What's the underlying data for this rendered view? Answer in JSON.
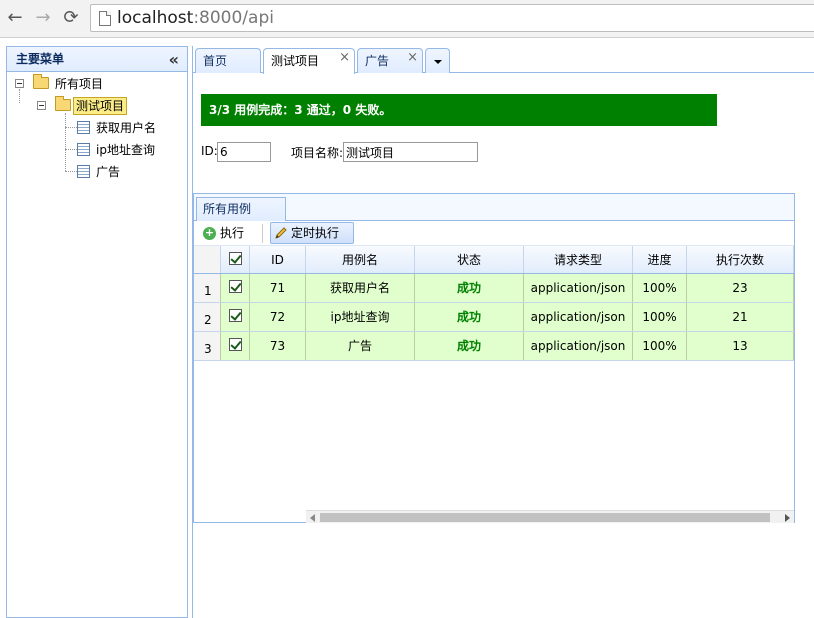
{
  "browser": {
    "url_host": "localhost",
    "url_rest": ":8000/api",
    "back_icon": "←",
    "forward_icon": "→",
    "reload_icon": "⟳"
  },
  "left_panel": {
    "title": "主要菜单",
    "collapse_icon": "«",
    "tree": {
      "root": "所有项目",
      "project": "测试项目",
      "items": [
        "获取用户名",
        "ip地址查询",
        "广告"
      ]
    }
  },
  "tabs": [
    {
      "label": "首页"
    },
    {
      "label": "测试项目",
      "close": "×"
    },
    {
      "label": "广告",
      "close": "×"
    }
  ],
  "progress": {
    "text": "3/3 用例完成：3 通过，0 失败。",
    "color": "#008000"
  },
  "form": {
    "id_label": "ID:",
    "id_value": "6",
    "name_label": "项目名称:",
    "name_value": "测试项目"
  },
  "subpanel": {
    "tab": "所有用例",
    "run_label": "执行",
    "timer_label": "定时执行"
  },
  "grid": {
    "columns": [
      "ID",
      "用例名",
      "状态",
      "请求类型",
      "进度",
      "执行次数"
    ],
    "rows": [
      {
        "num": "1",
        "id": "71",
        "name": "获取用户名",
        "status": "成功",
        "type": "application/json",
        "progress": "100%",
        "count": "23"
      },
      {
        "num": "2",
        "id": "72",
        "name": "ip地址查询",
        "status": "成功",
        "type": "application/json",
        "progress": "100%",
        "count": "21"
      },
      {
        "num": "3",
        "id": "73",
        "name": "广告",
        "status": "成功",
        "type": "application/json",
        "progress": "100%",
        "count": "13"
      }
    ],
    "row_color": "#e0ffcc"
  }
}
